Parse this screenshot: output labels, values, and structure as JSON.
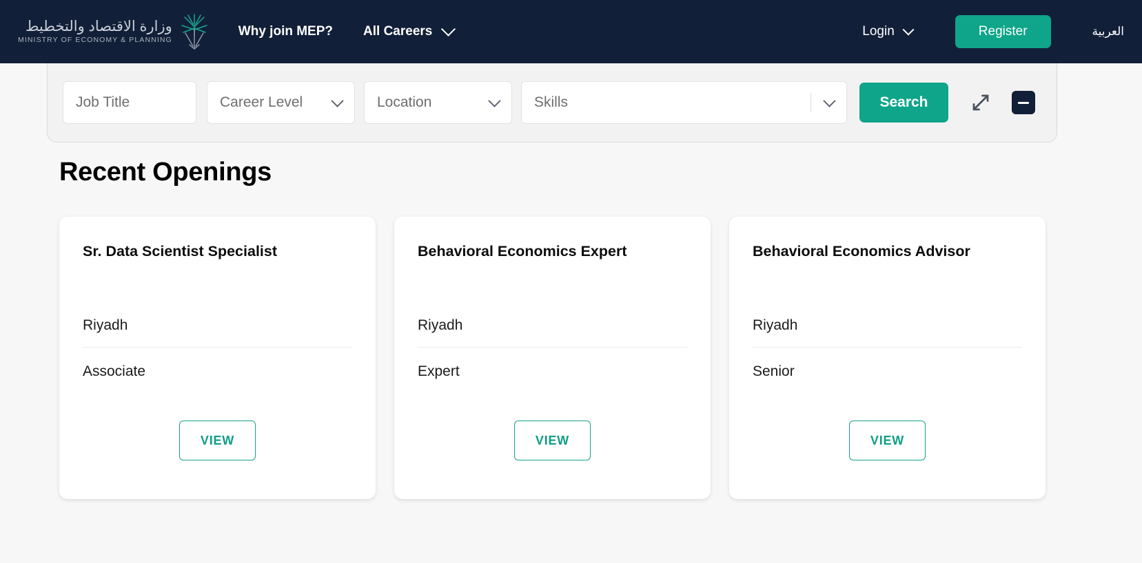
{
  "header": {
    "logo": {
      "arabic": "وزارة الاقتصاد والتخطيط",
      "english": "MINISTRY OF ECONOMY & PLANNING",
      "emblem_icon": "palm-emblem-icon",
      "emblem_color": "#18a890"
    },
    "nav": [
      {
        "label": "Why join MEP?",
        "has_dropdown": false
      },
      {
        "label": "All Careers",
        "has_dropdown": true
      }
    ],
    "login": {
      "label": "Login",
      "icon": "chevron-down-icon"
    },
    "register": {
      "label": "Register"
    },
    "language": {
      "label": "العربية"
    },
    "background_color": "#121f38"
  },
  "search": {
    "job_title": {
      "placeholder": "Job Title",
      "value": ""
    },
    "career_level": {
      "placeholder": "Career Level",
      "value": "",
      "icon": "chevron-down-icon"
    },
    "location": {
      "placeholder": "Location",
      "value": "",
      "icon": "chevron-down-icon"
    },
    "skills": {
      "placeholder": "Skills",
      "value": "",
      "icon": "chevron-down-icon"
    },
    "search_button": "Search",
    "expand_icon": "expand-arrows-icon",
    "collapse_button": {
      "icon": "minus-icon"
    },
    "accent_color": "#0fa58a"
  },
  "main": {
    "section_title": "Recent Openings",
    "view_label": "VIEW",
    "jobs": [
      {
        "title": "Sr. Data Scientist Specialist",
        "location": "Riyadh",
        "level": "Associate",
        "action": "VIEW"
      },
      {
        "title": "Behavioral Economics Expert",
        "location": "Riyadh",
        "level": "Expert",
        "action": "VIEW"
      },
      {
        "title": "Behavioral Economics Advisor",
        "location": "Riyadh",
        "level": "Senior",
        "action": "VIEW"
      }
    ]
  }
}
